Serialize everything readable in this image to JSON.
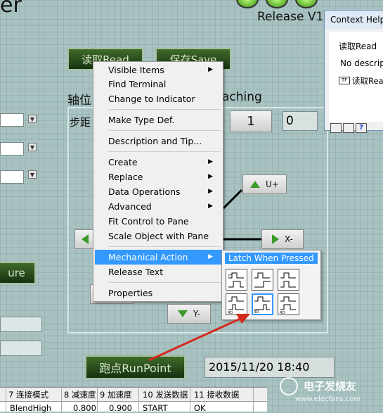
{
  "title_partial": "er",
  "release_label": "Release V1",
  "buttons": {
    "read": "读取Read",
    "save": "保存Save",
    "ure": "ure",
    "runpoint": "跑点RunPoint",
    "u_plus": "U+",
    "x_minus": "X-",
    "y_minus": "Y-",
    "one": "1",
    "zero": "0"
  },
  "labels": {
    "axis": "轴位",
    "teaching": "aching",
    "step": "步距"
  },
  "datetime": "2015/11/20   18:40",
  "context_help": {
    "title": "Context Help",
    "item_name": "读取Read",
    "description": "No descrip",
    "terminal_label": "读取Rea",
    "terminal_tag": "TF",
    "question": "?"
  },
  "menu": {
    "items": [
      {
        "label": "Visible Items",
        "submenu": true
      },
      {
        "label": "Find Terminal",
        "submenu": false
      },
      {
        "label": "Change to Indicator",
        "submenu": false
      },
      {
        "label": "Make Type Def.",
        "submenu": false
      },
      {
        "label": "Description and Tip...",
        "submenu": false
      },
      {
        "label": "Create",
        "submenu": true
      },
      {
        "label": "Replace",
        "submenu": true
      },
      {
        "label": "Data Operations",
        "submenu": true
      },
      {
        "label": "Advanced",
        "submenu": true
      },
      {
        "label": "Fit Control to Pane",
        "submenu": false
      },
      {
        "label": "Scale Object with Pane",
        "submenu": false
      },
      {
        "label": "Mechanical Action",
        "submenu": true
      },
      {
        "label": "Release Text",
        "submenu": false
      },
      {
        "label": "Properties",
        "submenu": false
      }
    ],
    "submenu_arrow": "▶"
  },
  "mechanical_action": {
    "selected": "Latch When Pressed"
  },
  "table": {
    "headers": [
      "7 连接模式",
      "8 减速度",
      "9 加速度",
      "10 发送数据",
      "11 接收数据"
    ],
    "row": [
      "BlendHigh",
      "0.800",
      "0.900",
      "START",
      "OK"
    ]
  },
  "watermark": "电子发烧友",
  "watermark_url": "www.elecfans.com",
  "colors": {
    "background": "#a8c2c2",
    "menu_highlight": "#3399ff",
    "green_button": "#2c4d1f",
    "arrow_red": "#d42a1f",
    "arrow_green": "#3b9a2a"
  }
}
